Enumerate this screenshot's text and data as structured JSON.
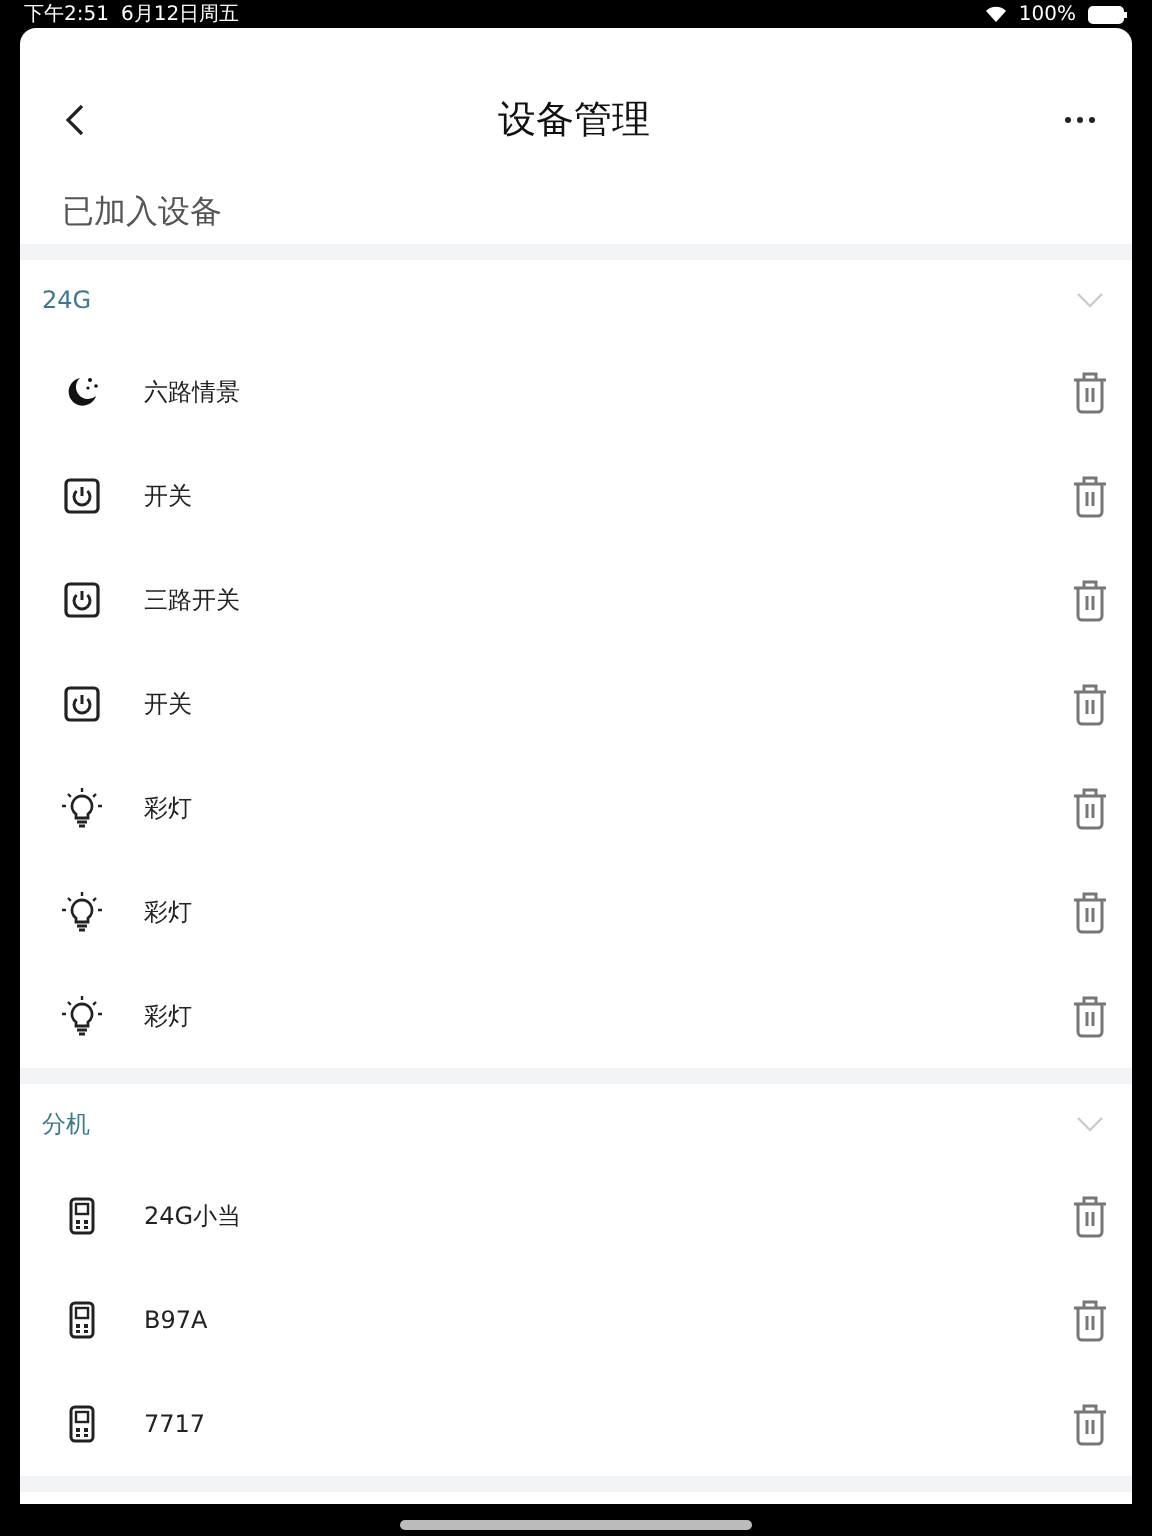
{
  "status_bar": {
    "time": "下午2:51",
    "date": "6月12日周五",
    "battery": "100%"
  },
  "nav": {
    "title": "设备管理"
  },
  "section_title": "已加入设备",
  "groups": [
    {
      "name": "24G",
      "expanded": true,
      "devices": [
        {
          "name": "六路情景",
          "kind": "scene"
        },
        {
          "name": "开关",
          "kind": "switch"
        },
        {
          "name": "三路开关",
          "kind": "switch"
        },
        {
          "name": "开关",
          "kind": "switch"
        },
        {
          "name": "彩灯",
          "kind": "light"
        },
        {
          "name": "彩灯",
          "kind": "light"
        },
        {
          "name": "彩灯",
          "kind": "light"
        }
      ]
    },
    {
      "name": "分机",
      "expanded": true,
      "devices": [
        {
          "name": "24G小当",
          "kind": "handset"
        },
        {
          "name": "B97A",
          "kind": "handset"
        },
        {
          "name": "7717",
          "kind": "handset"
        }
      ]
    }
  ]
}
